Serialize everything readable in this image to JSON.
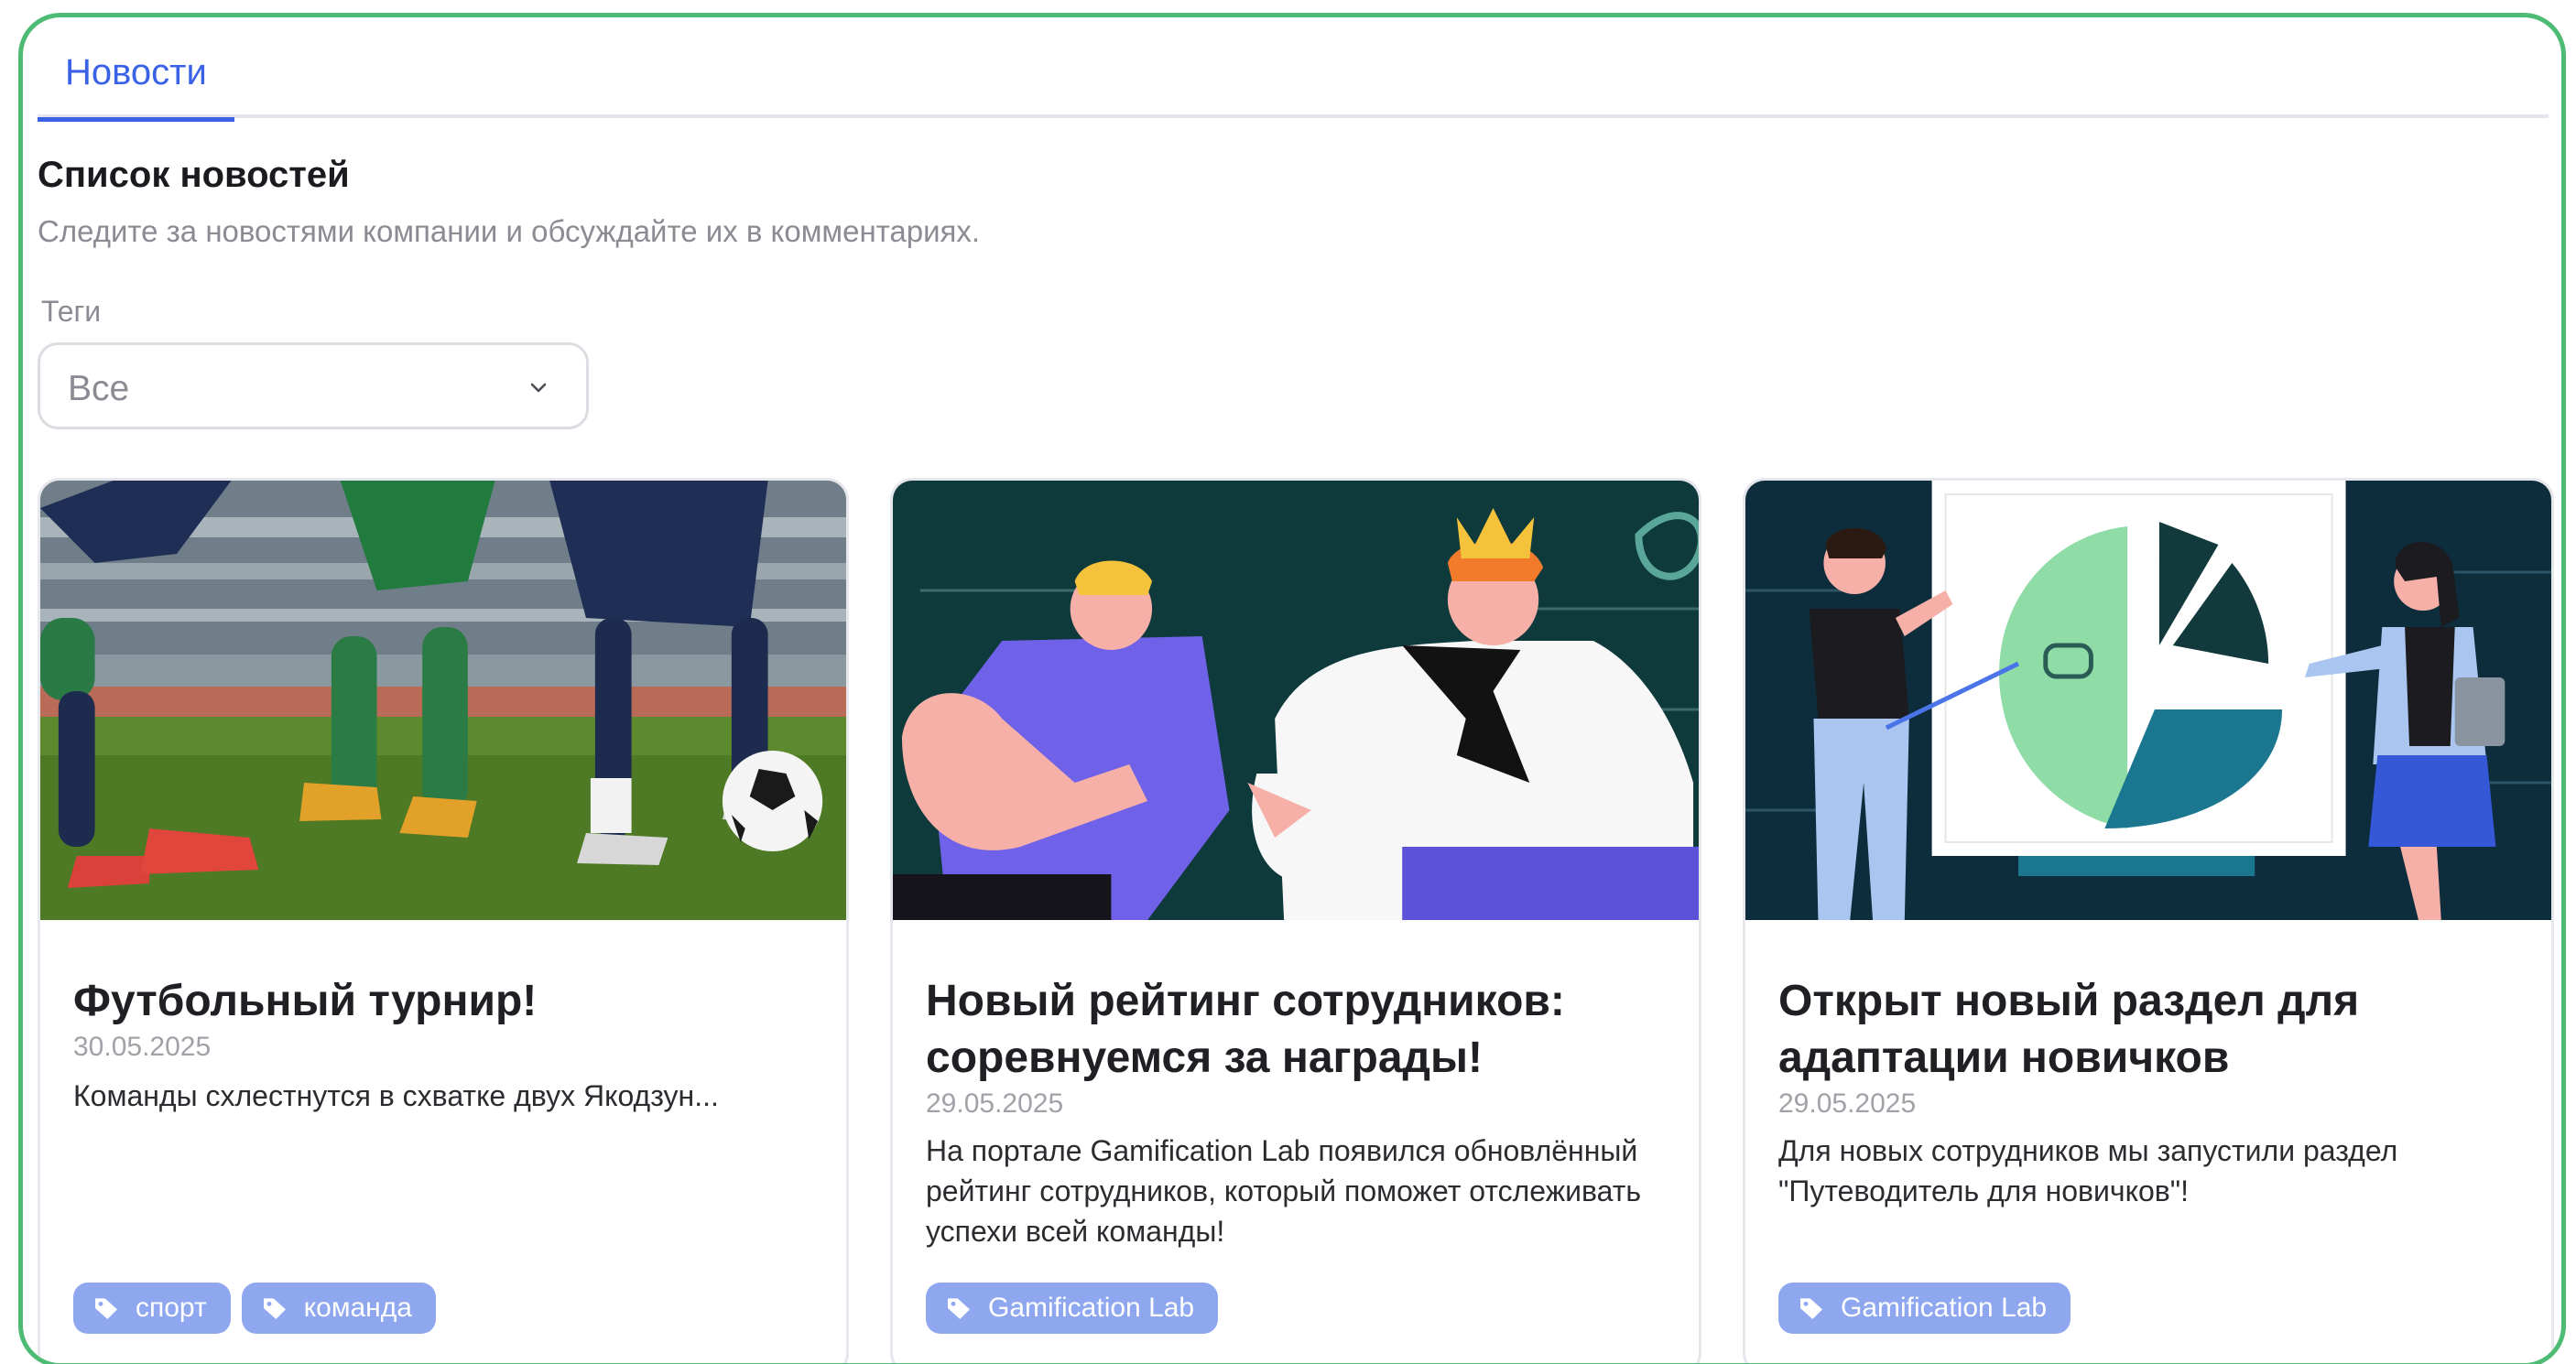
{
  "tabs": [
    {
      "label": "Новости",
      "active": true
    }
  ],
  "section": {
    "title": "Список новостей",
    "description": "Следите за новостями компании и обсуждайте их в комментариях."
  },
  "filter": {
    "label": "Теги",
    "value": "Все",
    "icon": "chevron-down-icon"
  },
  "colors": {
    "accent": "#3a62e6",
    "frame_border": "#4dbb73",
    "tag_bg": "#8fa7ef"
  },
  "news": [
    {
      "image": "football-match-illustration",
      "title": "Футбольный турнир!",
      "date": "30.05.2025",
      "text": "Команды схлестнутся в схватке двух Якодзун...",
      "tags": [
        "спорт",
        "команда"
      ]
    },
    {
      "image": "rating-illustration",
      "title": "Новый рейтинг сотрудников: соревнуемся за награды!",
      "date": "29.05.2025",
      "text": "На портале Gamification Lab появился обновлённый рейтинг сотрудников, который поможет отслеживать успехи всей команды!",
      "tags": [
        "Gamification Lab"
      ]
    },
    {
      "image": "onboarding-presentation-illustration",
      "title": "Открыт новый раздел для адаптации новичков",
      "date": "29.05.2025",
      "text": "Для новых сотрудников мы запустили раздел \"Путеводитель для новичков\"!",
      "tags": [
        "Gamification Lab"
      ]
    }
  ]
}
